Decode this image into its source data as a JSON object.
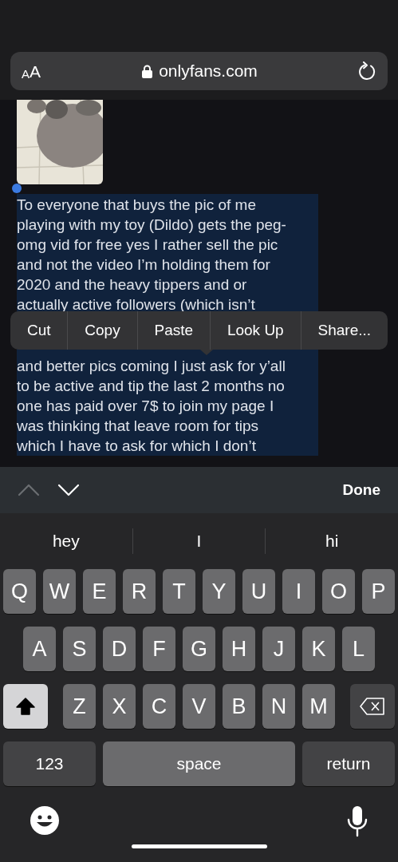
{
  "browser": {
    "text_size": {
      "small": "A",
      "large": "A"
    },
    "url": "onlyfans.com"
  },
  "post": {
    "picture": {
      "kind": "picture"
    },
    "lines_before_menu": [
      "To everyone that buys the pic of me",
      "playing with my toy (Dildo) gets the peg-",
      "omg vid for free yes I rather sell the pic",
      "and not the video I’m holding them for",
      "2020 and the heavy tippers and or",
      "actually active followers (which isn’t"
    ],
    "lines_after_menu": [
      "and better pics coming I just ask for y’all",
      "to be active and tip the last 2 months no",
      "one has paid over 7$ to join my page I",
      "was thinking that leave room for tips",
      "which I have to ask for which I don’t"
    ]
  },
  "edit_menu": [
    "Cut",
    "Copy",
    "Paste",
    "Look Up",
    "Share..."
  ],
  "find_toolbar": {
    "previous": {
      "disabled": true
    },
    "next": {
      "disabled": false
    },
    "done": "Done"
  },
  "suggestions": [
    "hey",
    "I",
    "hi"
  ],
  "keyboard": {
    "rows": [
      [
        {
          "kind": "letter",
          "label": "Q"
        },
        {
          "kind": "letter",
          "label": "W"
        },
        {
          "kind": "letter",
          "label": "E"
        },
        {
          "kind": "letter",
          "label": "R"
        },
        {
          "kind": "letter",
          "label": "T"
        },
        {
          "kind": "letter",
          "label": "Y"
        },
        {
          "kind": "letter",
          "label": "U"
        },
        {
          "kind": "letter",
          "label": "I"
        },
        {
          "kind": "letter",
          "label": "O"
        },
        {
          "kind": "letter",
          "label": "P"
        }
      ],
      [
        {
          "kind": "letter",
          "label": "A"
        },
        {
          "kind": "letter",
          "label": "S"
        },
        {
          "kind": "letter",
          "label": "D"
        },
        {
          "kind": "letter",
          "label": "F"
        },
        {
          "kind": "letter",
          "label": "G"
        },
        {
          "kind": "letter",
          "label": "H"
        },
        {
          "kind": "letter",
          "label": "J"
        },
        {
          "kind": "letter",
          "label": "K"
        },
        {
          "kind": "letter",
          "label": "L"
        }
      ],
      [
        {
          "kind": "shift",
          "on": true
        },
        {
          "kind": "letter",
          "label": "Z"
        },
        {
          "kind": "letter",
          "label": "X"
        },
        {
          "kind": "letter",
          "label": "C"
        },
        {
          "kind": "letter",
          "label": "V"
        },
        {
          "kind": "letter",
          "label": "B"
        },
        {
          "kind": "letter",
          "label": "N"
        },
        {
          "kind": "letter",
          "label": "M"
        },
        {
          "kind": "delete"
        }
      ]
    ],
    "bottom_keys": {
      "numbers": "123",
      "space": "space",
      "return": "return"
    }
  }
}
